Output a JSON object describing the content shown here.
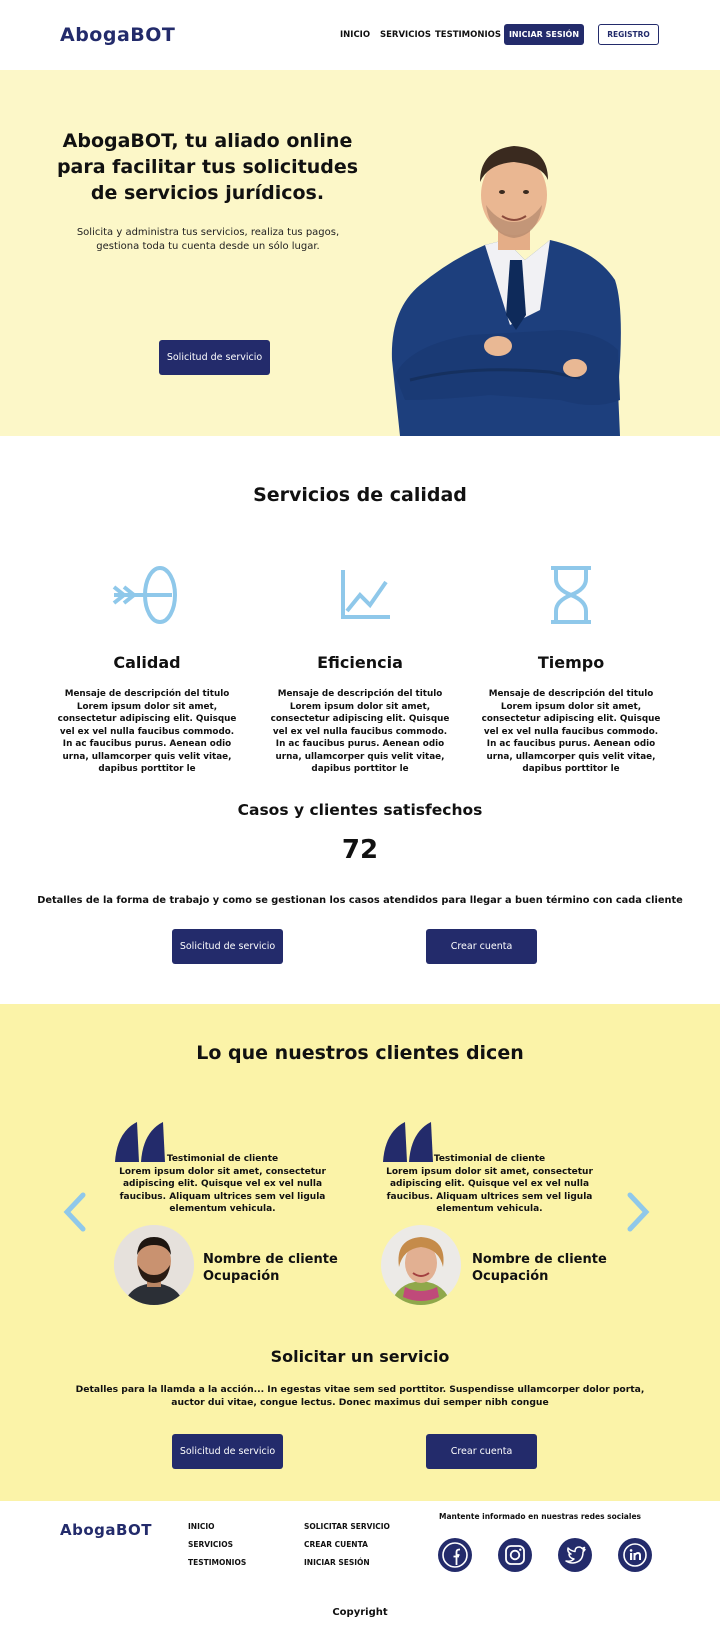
{
  "brand": {
    "logo_bold": "Aboga",
    "logo_rest": "BOT"
  },
  "nav": {
    "inicio": "INICIO",
    "servicios": "SERVICIOS",
    "testimonios": "TESTIMONIOS",
    "login": "INICIAR SESIÓN",
    "register": "REGISTRO"
  },
  "hero": {
    "title": "AbogaBOT, tu aliado online para facilitar tus solicitudes de servicios jurídicos.",
    "subtitle": "Solicita y administra tus servicios, realiza tus pagos, gestiona toda tu cuenta desde un sólo lugar.",
    "cta": "Solicitud de servicio"
  },
  "services": {
    "title": "Servicios de calidad",
    "items": [
      {
        "icon": "target-arrow-icon",
        "title": "Calidad",
        "text": "Mensaje de descripción del titulo Lorem ipsum dolor sit amet, consectetur adipiscing elit. Quisque vel ex vel nulla faucibus commodo. In ac faucibus purus. Aenean odio urna, ullamcorper quis velit vitae, dapibus porttitor le"
      },
      {
        "icon": "line-chart-icon",
        "title": "Eficiencia",
        "text": "Mensaje de descripción del titulo Lorem ipsum dolor sit amet, consectetur adipiscing elit. Quisque vel ex vel nulla faucibus commodo. In ac faucibus purus. Aenean odio urna, ullamcorper quis velit vitae, dapibus porttitor le"
      },
      {
        "icon": "hourglass-icon",
        "title": "Tiempo",
        "text": "Mensaje de descripción del titulo Lorem ipsum dolor sit amet, consectetur adipiscing elit. Quisque vel ex vel nulla faucibus commodo. In ac faucibus purus. Aenean odio urna, ullamcorper quis velit vitae, dapibus porttitor le"
      }
    ]
  },
  "cases": {
    "title": "Casos y clientes satisfechos",
    "count": "72",
    "details": "Detalles de la forma de trabajo y como se gestionan los casos atendidos para llegar a buen término con cada cliente",
    "cta_service": "Solicitud de servicio",
    "cta_account": "Crear cuenta"
  },
  "testimonials": {
    "title": "Lo que nuestros clientes dicen",
    "items": [
      {
        "heading": "Testimonial de cliente",
        "text": "Lorem ipsum dolor sit amet, consectetur adipiscing elit. Quisque vel ex vel nulla faucibus. Aliquam ultrices sem vel ligula elementum vehicula.",
        "name": "Nombre de cliente",
        "role": "Ocupación"
      },
      {
        "heading": "Testimonial de cliente",
        "text": "Lorem ipsum dolor sit amet, consectetur adipiscing elit. Quisque vel ex vel nulla faucibus. Aliquam ultrices sem vel ligula elementum vehicula.",
        "name": "Nombre de cliente",
        "role": "Ocupación"
      }
    ]
  },
  "request": {
    "title": "Solicitar un servicio",
    "details": "Detalles para la llamda a la acción... In egestas vitae sem sed porttitor. Suspendisse ullamcorper dolor porta, auctor dui vitae, congue lectus. Donec maximus dui semper nibh congue",
    "cta_service": "Solicitud de servicio",
    "cta_account": "Crear cuenta"
  },
  "footer": {
    "col1": [
      "INICIO",
      "SERVICIOS",
      "TESTIMONIOS"
    ],
    "col2": [
      "SOLICITAR SERVICIO",
      "CREAR CUENTA",
      "INICIAR SESIÓN"
    ],
    "social_label": "Mantente informado en nuestras redes sociales",
    "social": [
      "facebook-icon",
      "instagram-icon",
      "twitter-icon",
      "linkedin-icon"
    ],
    "copyright": "Copyright"
  },
  "colors": {
    "brand": "#232b6b",
    "hero_bg": "#fcf7c8",
    "testimonial_bg": "#fbf3a8",
    "icon_blue": "#8fc8ea"
  }
}
